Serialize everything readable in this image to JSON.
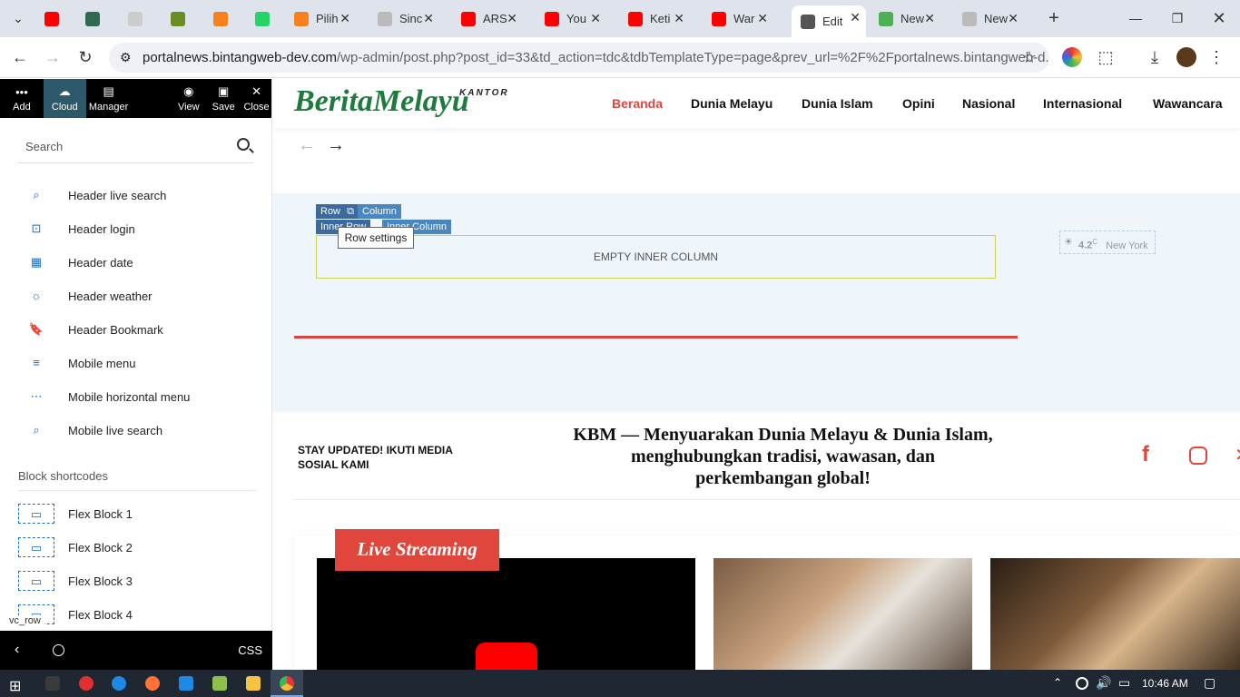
{
  "browser": {
    "tabs": [
      {
        "label": "",
        "color": "#ff0000"
      },
      {
        "label": "",
        "color": "#2d6a4f"
      },
      {
        "label": "",
        "color": "#cccccc"
      },
      {
        "label": "",
        "color": "#6b8e23"
      },
      {
        "label": "",
        "color": "#f5821f"
      },
      {
        "label": "",
        "color": "#25d366"
      },
      {
        "label": "Pilih",
        "color": "#f5821f"
      },
      {
        "label": "Sinc",
        "color": "#bbbbbb"
      },
      {
        "label": "ARS",
        "color": "#ff0000"
      },
      {
        "label": "You",
        "color": "#ff0000"
      },
      {
        "label": "Keti",
        "color": "#ff0000"
      },
      {
        "label": "War",
        "color": "#ff0000"
      },
      {
        "label": "Edit",
        "color": "#555555"
      },
      {
        "label": "New",
        "color": "#4caf50"
      },
      {
        "label": "New",
        "color": "#bbbbbb"
      }
    ],
    "url_domain": "portalnews.bintangweb-dev.com",
    "url_rest": "/wp-admin/post.php?post_id=33&td_action=tdc&tdbTemplateType=page&prev_url=%2F%2Fportalnews.bintangweb-d..."
  },
  "sidebar": {
    "toolbar": [
      {
        "label": "Add",
        "icon": "dots-icon"
      },
      {
        "label": "Cloud",
        "icon": "cloud-icon"
      },
      {
        "label": "Manager",
        "icon": "manager-icon"
      },
      {
        "label": "View",
        "icon": "eye-icon"
      },
      {
        "label": "Save",
        "icon": "save-icon"
      },
      {
        "label": "Close",
        "icon": "close-icon"
      }
    ],
    "search_placeholder": "Search",
    "items": [
      {
        "label": "Header live search",
        "icon": "header-live-search-icon"
      },
      {
        "label": "Header login",
        "icon": "header-login-icon"
      },
      {
        "label": "Header date",
        "icon": "header-date-icon"
      },
      {
        "label": "Header weather",
        "icon": "header-weather-icon"
      },
      {
        "label": "Header Bookmark",
        "icon": "header-bookmark-icon"
      },
      {
        "label": "Mobile menu",
        "icon": "mobile-menu-icon"
      },
      {
        "label": "Mobile horizontal menu",
        "icon": "mobile-horizontal-menu-icon"
      },
      {
        "label": "Mobile live search",
        "icon": "mobile-live-search-icon"
      }
    ],
    "section": "Block shortcodes",
    "blocks": [
      "Flex Block 1",
      "Flex Block 2",
      "Flex Block 3",
      "Flex Block 4"
    ],
    "vc_row": "vc_row",
    "css_label": "CSS"
  },
  "site": {
    "logo": "BeritaMelayu",
    "logo_sub": "KANTOR",
    "nav": [
      "Beranda",
      "Dunia Melayu",
      "Dunia Islam",
      "Opini",
      "Nasional",
      "Internasional",
      "Wawancara"
    ],
    "row_tag": "Row",
    "column_tag": "Column",
    "inner_row_tag": "Inner Row",
    "inner_column_tag": "Inner Column",
    "row_settings": "Row settings",
    "empty_inner": "EMPTY INNER COLUMN",
    "weather_temp": "4.2",
    "weather_unit": "C",
    "weather_city": "New York",
    "stay": "STAY UPDATED! IKUTI MEDIA SOSIAL KAMI",
    "tagline": "KBM — Menyuarakan Dunia Melayu & Dunia Islam, menghubungkan tradisi, wawasan, dan perkembangan global!",
    "live": "Live Streaming"
  },
  "taskbar": {
    "time": "10:46 AM"
  }
}
